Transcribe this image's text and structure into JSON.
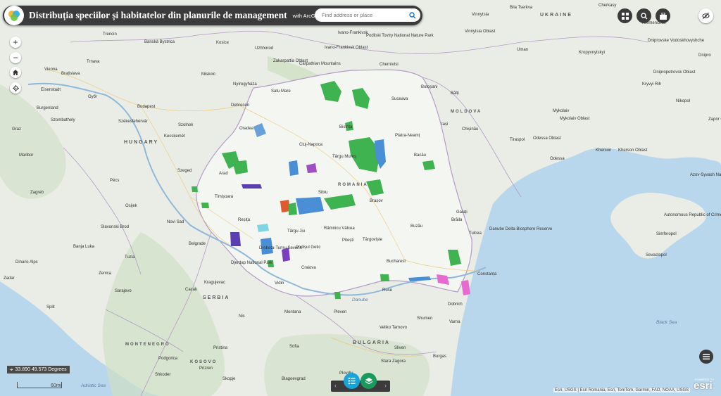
{
  "header": {
    "title": "Distribuția speciilor și habitatelor din planurile de management",
    "subtitle": "with ArcGIS Web AppBuilder"
  },
  "search": {
    "placeholder": "Find address or place"
  },
  "coords": {
    "text": "33.890 49.573 Degrees"
  },
  "scale": {
    "label": "60mi"
  },
  "attribution": "Esri, USGS | Esri Romania, Esri, TomTom, Garmin, FAO, NOAA, USGS",
  "esri": {
    "logo": "esri",
    "powered": "POWERED BY"
  },
  "icons": {
    "logo": "app-logo-icon",
    "search": "search-icon",
    "grid": "grid-icon",
    "zoom": "magnifier-icon",
    "briefcase": "briefcase-icon",
    "visibility": "eye-slash-icon",
    "home": "home-icon",
    "locate": "locate-icon",
    "legend": "legend-icon",
    "layers": "layers-icon",
    "list": "list-icon"
  },
  "colors": {
    "header": "#3b3b3b",
    "accent_blue": "#1aa3d9",
    "accent_green": "#1a9a5c",
    "land": "#e9ede6",
    "water": "#b9d7ec",
    "forest": "#cfe0c4"
  },
  "countries": [
    "UKRAINE",
    "HUNGARY",
    "ROMANIA",
    "MOLDOVA",
    "SERBIA",
    "BULGARIA",
    "MONTENEGRO",
    "KOSOVO"
  ],
  "seas": [
    "Adriatic Sea",
    "Black Sea",
    "Danube"
  ],
  "places": [
    "Cherkasy",
    "Vinnytsia",
    "Vinnytsia Oblast",
    "Kremenchuk",
    "Dnipro",
    "Kropyvnytskyi",
    "Dnipropetrovsk Oblast",
    "Kryvyi Rih",
    "Nikopol",
    "Zapor Oblast",
    "Bila Tserkva",
    "Uman",
    "Dniprovske Vodoskhovyshche",
    "Mykolaiv",
    "Mykolaiv Oblast",
    "Odessa",
    "Odessa Oblast",
    "Kherson",
    "Kherson Oblast",
    "Azov-Syvash National Park",
    "Autonomous Republic of Crimea",
    "Simferopol",
    "Sevastopol",
    "Ivano-Frankivsk",
    "Ivano-Frankivsk Oblast",
    "Podilski Tovtry National Nature Park",
    "Chernivtsi",
    "Bălți",
    "Chișinău",
    "Tiraspol",
    "Uzhhorod",
    "Zakarpattia Oblast",
    "Carpathian Mountains",
    "Satu Mare",
    "Suceava",
    "Iași",
    "Botoșani",
    "Kosice",
    "Miskolc",
    "Nyíregyháza",
    "Debrecen",
    "Bistrița",
    "Piatra-Neamț",
    "Bacău",
    "Cluj-Napoca",
    "Oradea",
    "Târgu Mureș",
    "Vienna",
    "Bratislava",
    "Banská Bystrica",
    "Trencin",
    "Trnava",
    "Győr",
    "Eisenstadt",
    "Burgenland",
    "Szombathely",
    "Budapest",
    "Szolnok",
    "Székesfehérvár",
    "Kecskemét",
    "Szeged",
    "Graz",
    "Maribor",
    "Pécs",
    "Arad",
    "Timișoara",
    "Sibiu",
    "Brașov",
    "Galați",
    "Brăila",
    "Reșița",
    "Târgu Jiu",
    "Râmnicu Vâlcea",
    "Pitești",
    "Târgoviște",
    "Buzău",
    "Tulcea",
    "Danube Delta Biosphere Reserve",
    "Constanța",
    "Bucharest",
    "Ruse",
    "Craiova",
    "Drobeta-Turnu Severin",
    "Djerdap National Park",
    "Podișul Getic",
    "Vidin",
    "Dobrich",
    "Varna",
    "Shumen",
    "Veliko Tarnovo",
    "Pleven",
    "Montana",
    "Zagreb",
    "Osijek",
    "Novi Sad",
    "Belgrade",
    "Slavonski Brod",
    "Banja Luka",
    "Tuzla",
    "Zenica",
    "Sarajevo",
    "Split",
    "Zadar",
    "Kragujevac",
    "Cacak",
    "Nis",
    "Podgorica",
    "Pristina",
    "Prizren",
    "Skopje",
    "Shkoder",
    "Sofia",
    "Plovdiv",
    "Blagoevgrad",
    "Stara Zagora",
    "Sliven",
    "Burgas",
    "Dinaric Alps"
  ]
}
